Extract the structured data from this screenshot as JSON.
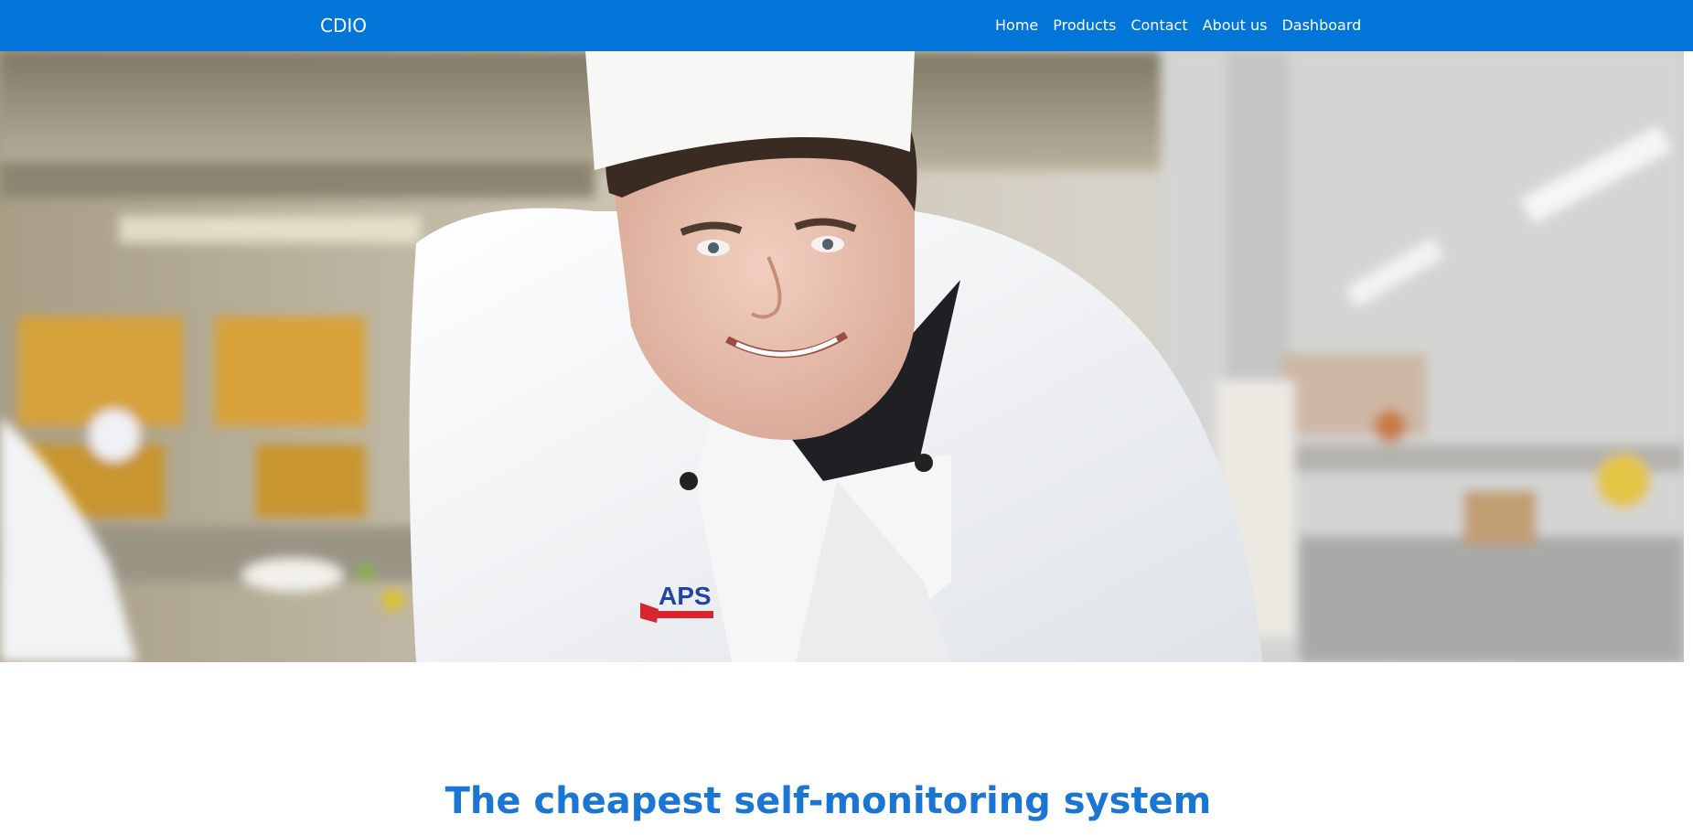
{
  "navbar": {
    "brand": "CDIO",
    "links": [
      {
        "label": "Home"
      },
      {
        "label": "Products"
      },
      {
        "label": "Contact"
      },
      {
        "label": "About us"
      },
      {
        "label": "Dashboard"
      }
    ],
    "background_color": "#0275d8"
  },
  "hero": {
    "image_subject": "smiling chef in white uniform leaning over a kitchen counter",
    "logo_text": "APS"
  },
  "main": {
    "headline": "The cheapest self-monitoring system",
    "headline_color": "#1976d2"
  }
}
